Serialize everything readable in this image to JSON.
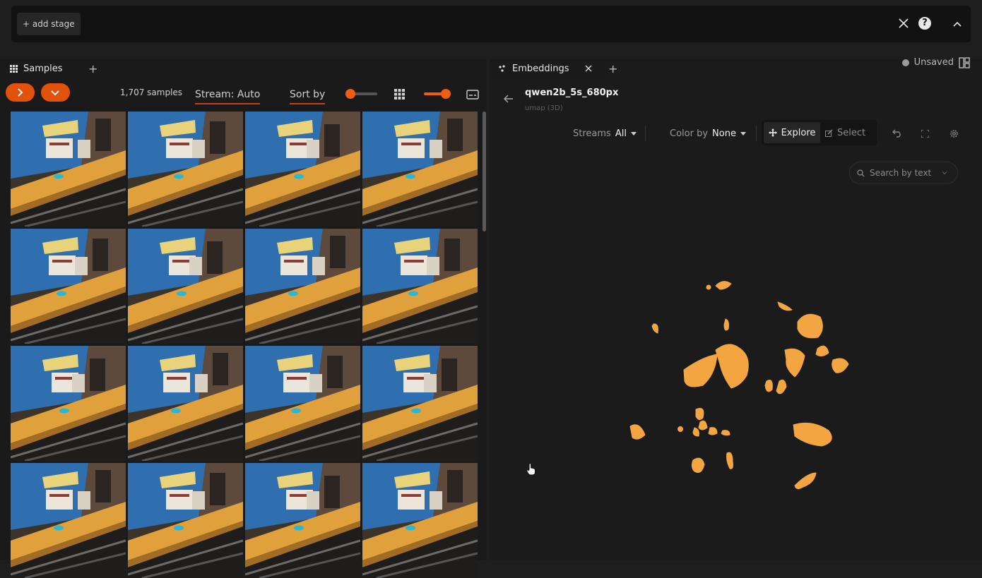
{
  "stage_bar": {
    "add_stage_label": "+ add stage"
  },
  "left_panel": {
    "tab_label": "Samples",
    "sample_count": "1,707 samples",
    "stream_label": "Stream: Auto",
    "sort_label": "Sort by",
    "grid_rows": 4,
    "grid_cols": 4
  },
  "right_panel": {
    "tab_label": "Embeddings",
    "unsaved_label": "Unsaved",
    "embedding_name": "qwen2b_5s_680px",
    "embedding_method": "umap (3D)",
    "streams_label": "Streams",
    "streams_value": "All",
    "color_by_label": "Color by",
    "color_by_value": "None",
    "explore_label": "Explore",
    "select_label": "Select",
    "search_placeholder": "Search by text"
  },
  "icons": [
    "grid-icon",
    "plus-icon",
    "close-icon",
    "help-icon",
    "chevron-up-icon",
    "chevron-right-icon",
    "chevron-down-icon",
    "grid-view-icon",
    "caption-icon",
    "scatter-icon",
    "back-arrow-icon",
    "explore-move-icon",
    "select-edit-icon",
    "undo-icon",
    "fullscreen-icon",
    "settings-icon",
    "search-icon",
    "layout-icon",
    "cursor-hand-icon"
  ],
  "colors": {
    "accent_orange": "#e2520b",
    "point_color": "#f2a541",
    "background": "#1e1e1e"
  }
}
